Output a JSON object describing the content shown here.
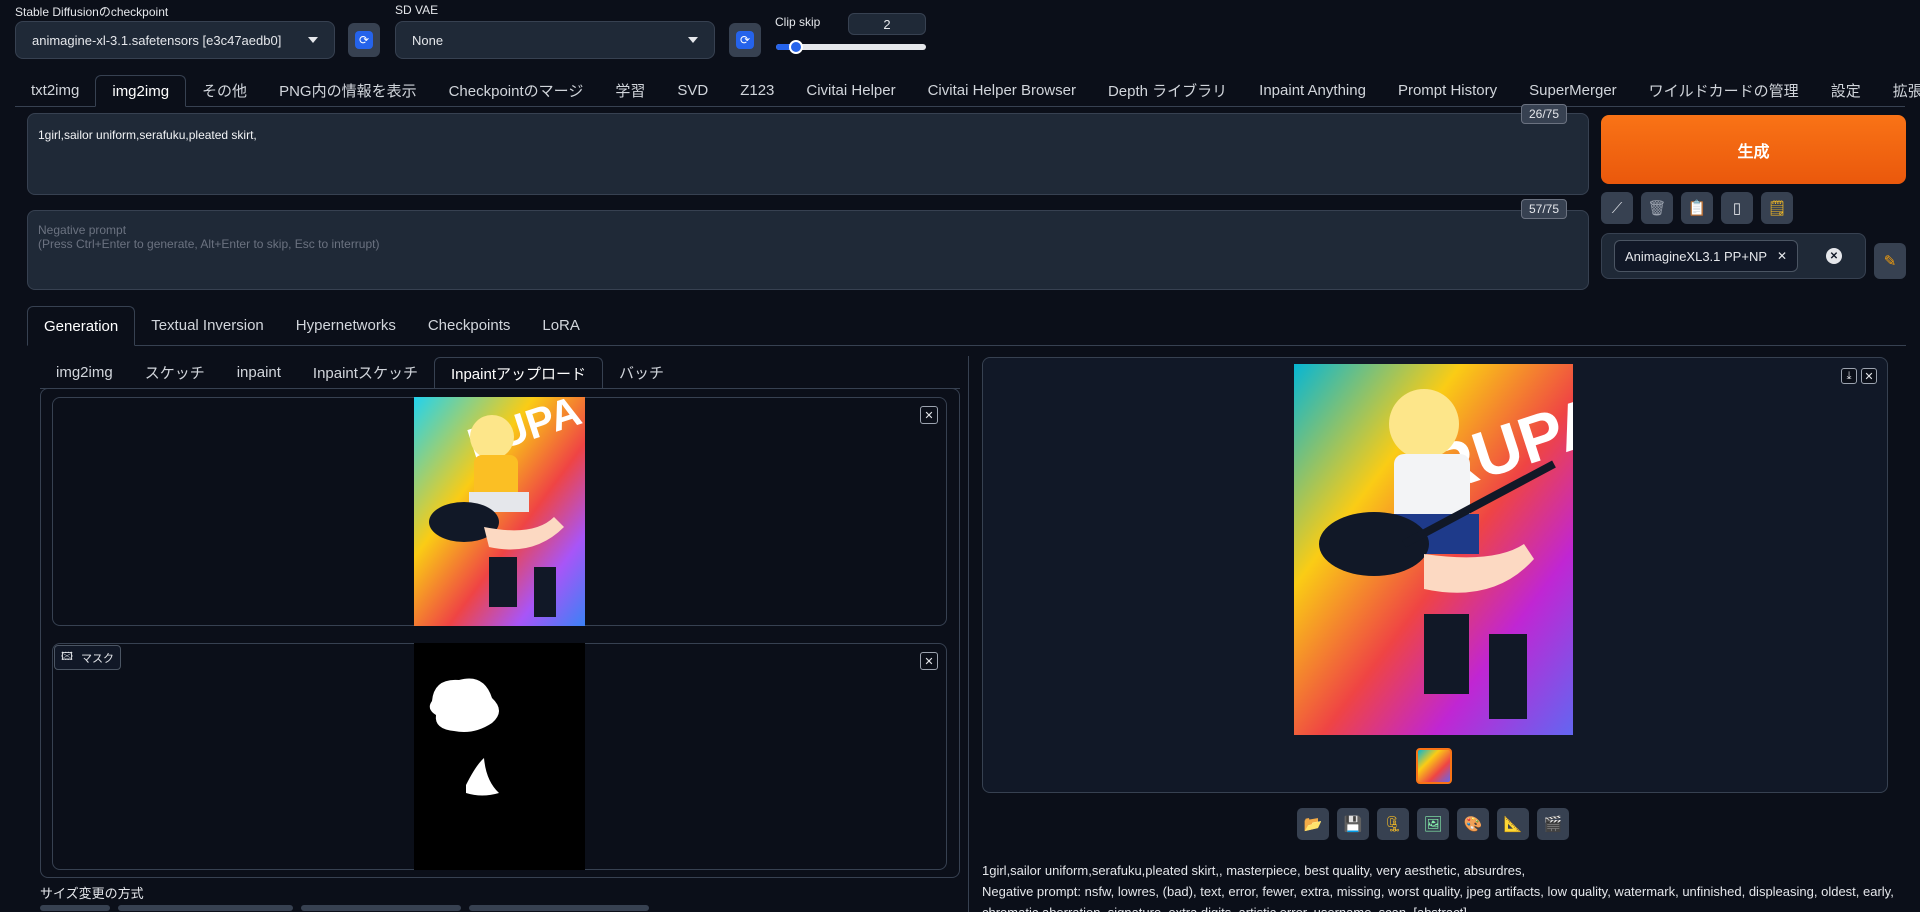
{
  "header": {
    "checkpoint_label": "Stable Diffusionのcheckpoint",
    "checkpoint_value": "animagine-xl-3.1.safetensors [e3c47aedb0]",
    "vae_label": "SD VAE",
    "vae_value": "None",
    "clip_skip_label": "Clip skip",
    "clip_skip_value": "2",
    "clip_skip_level": 0.1
  },
  "main_tabs": [
    "txt2img",
    "img2img",
    "その他",
    "PNG内の情報を表示",
    "Checkpointのマージ",
    "学習",
    "SVD",
    "Z123",
    "Civitai Helper",
    "Civitai Helper Browser",
    "Depth ライブラリ",
    "Inpaint Anything",
    "Prompt History",
    "SuperMerger",
    "ワイルドカードの管理",
    "設定",
    "拡張機能"
  ],
  "prompt": {
    "text": "1girl,sailor uniform,serafuku,pleated skirt,",
    "counter": "26/75",
    "negative_placeholder_line1": "Negative prompt",
    "negative_placeholder_line2": "(Press Ctrl+Enter to generate, Alt+Enter to skip, Esc to interrupt)",
    "negative_counter": "57/75"
  },
  "generate_label": "生成",
  "style_chip": "AnimagineXL3.1 PP+NP",
  "sub_tabs": [
    "Generation",
    "Textual Inversion",
    "Hypernetworks",
    "Checkpoints",
    "LoRA"
  ],
  "img_tabs": [
    "img2img",
    "スケッチ",
    "inpaint",
    "Inpaintスケッチ",
    "Inpaintアップロード",
    "バッチ"
  ],
  "mask_label": "マスク",
  "resize_label": "サイズ変更の方式",
  "output_info": {
    "line1": "1girl,sailor uniform,serafuku,pleated skirt,, masterpiece, best quality, very aesthetic, absurdres,",
    "line2": "Negative prompt: nsfw, lowres, (bad), text, error, fewer, extra, missing, worst quality, jpeg artifacts, low quality, watermark, unfinished, displeasing, oldest, early,",
    "line3": "chromatic aberration, signature, extra digits, artistic error, username, scan, [abstract]"
  },
  "image_text": "RUPA",
  "colors": {
    "accent": "#2563eb",
    "generate": "#f97316",
    "background": "#0b0f19"
  },
  "icons": {
    "tools": [
      "pencil-icon",
      "trash-icon",
      "clipboard-icon",
      "bookmark-icon",
      "note-icon"
    ],
    "gallery_buttons": [
      "folder-icon",
      "save-icon",
      "zip-icon",
      "image-icon",
      "palette-icon",
      "ruler-icon",
      "clapper-icon"
    ]
  }
}
